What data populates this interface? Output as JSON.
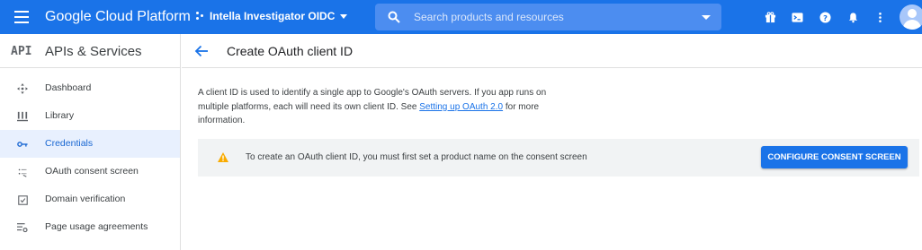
{
  "topbar": {
    "brand": "Google Cloud Platform",
    "project": "Intella Investigator OIDC",
    "search_placeholder": "Search products and resources",
    "color": "#1a73e8"
  },
  "sidebar": {
    "api_badge": "API",
    "title": "APIs & Services",
    "items": [
      {
        "label": "Dashboard",
        "icon": "dashboard-icon"
      },
      {
        "label": "Library",
        "icon": "library-icon"
      },
      {
        "label": "Credentials",
        "icon": "key-icon",
        "active": true
      },
      {
        "label": "OAuth consent screen",
        "icon": "consent-icon"
      },
      {
        "label": "Domain verification",
        "icon": "checkbox-icon"
      },
      {
        "label": "Page usage agreements",
        "icon": "settings-list-icon"
      }
    ]
  },
  "main": {
    "title": "Create OAuth client ID",
    "description_1": "A client ID is used to identify a single app to Google's OAuth servers. If you app runs on multiple platforms, each will need its own client ID. See ",
    "description_link": "Setting up OAuth 2.0",
    "description_2": " for more information.",
    "notice_text": "To create an OAuth client ID, you must first set a product name on the consent screen",
    "notice_button": "CONFIGURE CONSENT SCREEN",
    "warning_color": "#f9ab00"
  }
}
